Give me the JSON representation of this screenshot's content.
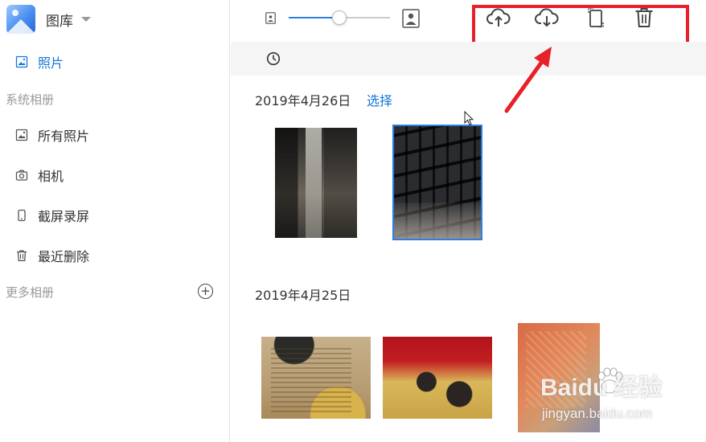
{
  "app": {
    "title": "图库"
  },
  "sidebar": {
    "photos_label": "照片",
    "system_albums_label": "系统相册",
    "system_albums": [
      {
        "label": "所有照片",
        "icon": "image-icon"
      },
      {
        "label": "相机",
        "icon": "camera-icon"
      },
      {
        "label": "截屏录屏",
        "icon": "phone-icon"
      },
      {
        "label": "最近删除",
        "icon": "trash-icon"
      }
    ],
    "more_albums_label": "更多相册"
  },
  "toolbar": {
    "thumbnail_size": 0.5,
    "actions": [
      "cloud-upload-icon",
      "cloud-download-icon",
      "rotate-icon",
      "delete-icon"
    ]
  },
  "groups": [
    {
      "date": "2019年4月26日",
      "select_label": "选择"
    },
    {
      "date": "2019年4月25日"
    }
  ],
  "watermark": {
    "brand": "Baidu 经验",
    "site": "jingyan.baidu.com"
  },
  "colors": {
    "accent": "#1677d9",
    "annotation": "#e8202a"
  }
}
